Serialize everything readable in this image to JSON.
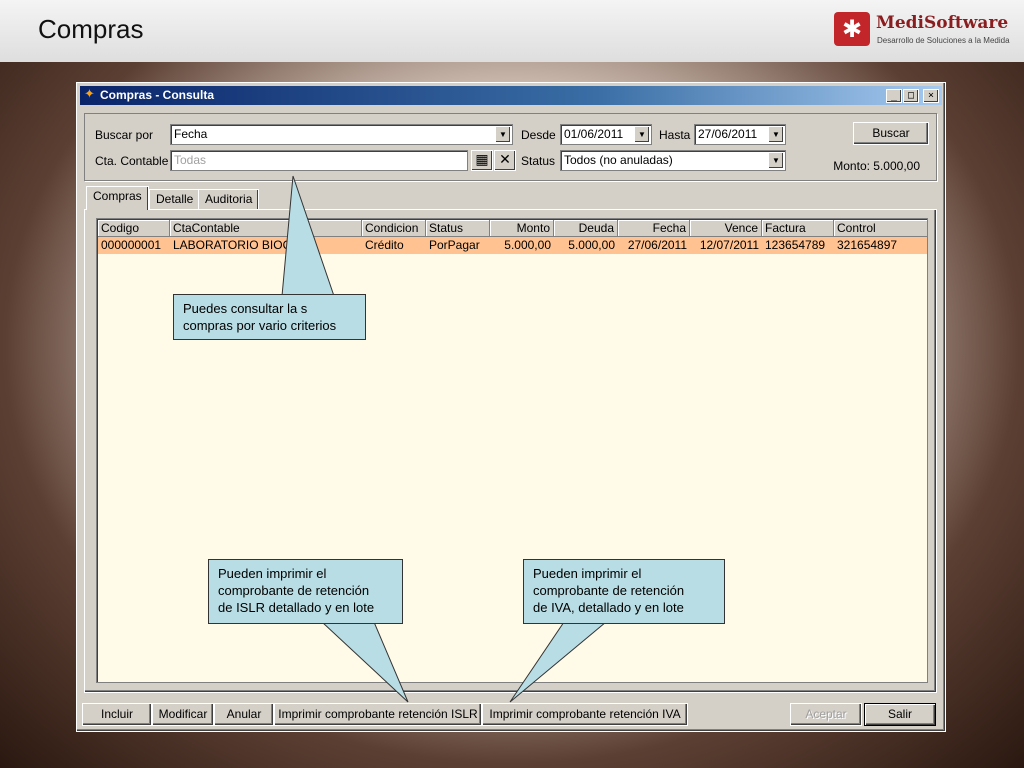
{
  "slide": {
    "title": "Compras"
  },
  "logo": {
    "name": "MediSoftware",
    "tagline": "Desarrollo de Soluciones a la Medida"
  },
  "window": {
    "title": "Compras - Consulta",
    "controls": {
      "minimize": "_",
      "maximize": "□",
      "close": "×"
    }
  },
  "filters": {
    "buscar_por": {
      "label": "Buscar por",
      "value": "Fecha"
    },
    "cta_contable": {
      "label": "Cta. Contable",
      "value": "Todas"
    },
    "desde": {
      "label": "Desde",
      "value": "01/06/2011"
    },
    "hasta": {
      "label": "Hasta",
      "value": "27/06/2011"
    },
    "status": {
      "label": "Status",
      "value": "Todos (no anuladas)"
    },
    "buscar_button": "Buscar",
    "monto": "Monto: 5.000,00"
  },
  "tabs": [
    {
      "label": "Compras"
    },
    {
      "label": "Detalle"
    },
    {
      "label": "Auditoria"
    }
  ],
  "table": {
    "columns": [
      "Codigo",
      "CtaContable",
      "Condicion",
      "Status",
      "Monto",
      "Deuda",
      "Fecha",
      "Vence",
      "Factura",
      "Control"
    ],
    "rows": [
      [
        "000000001",
        "LABORATORIO BIOQ",
        "Crédito",
        "PorPagar",
        "5.000,00",
        "5.000,00",
        "27/06/2011",
        "12/07/2011",
        "123654789",
        "321654897"
      ]
    ]
  },
  "buttons": {
    "incluir": "Incluir",
    "modificar": "Modificar",
    "anular": "Anular",
    "imprimir_islr": "Imprimir comprobante retención ISLR",
    "imprimir_iva": "Imprimir comprobante retención IVA",
    "aceptar": "Aceptar",
    "salir": "Salir"
  },
  "callouts": {
    "consultar": [
      "Puedes consultar la s",
      "compras por vario criterios"
    ],
    "islr": [
      "Pueden imprimir el",
      "comprobante de retención",
      "de ISLR detallado y en lote"
    ],
    "iva": [
      "Pueden imprimir el",
      "comprobante de retención",
      "de IVA, detallado y en lote"
    ]
  },
  "colors": {
    "selected_row": "#ffc290",
    "grid_bg": "#fffbe8",
    "callout_bg": "#b9dde4",
    "titlebar": "#0a246a"
  }
}
